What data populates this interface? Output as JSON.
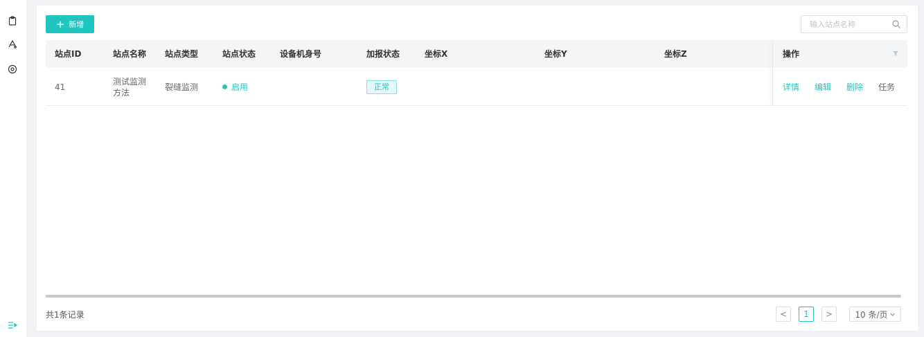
{
  "sidebar": {
    "icons": [
      "clipboard-icon",
      "station-icon",
      "settings-icon",
      "menu-collapse-icon"
    ]
  },
  "toolbar": {
    "add_label": "新增",
    "search_placeholder": "输入站点名称"
  },
  "table": {
    "headers": {
      "id": "站点ID",
      "name": "站点名称",
      "type": "站点类型",
      "status": "站点状态",
      "device": "设备机身号",
      "report": "加报状态",
      "x": "坐标X",
      "y": "坐标Y",
      "z": "坐标Z",
      "actions": "操作"
    },
    "rows": [
      {
        "id": "41",
        "name": "测试监测方法",
        "type": "裂缝监测",
        "status": "启用",
        "device": "",
        "report": "正常",
        "x": "",
        "y": "",
        "z": "",
        "actions": {
          "detail": "详情",
          "edit": "编辑",
          "delete": "删除",
          "task": "任务"
        }
      }
    ]
  },
  "footer": {
    "total": "共1条记录",
    "page": "1",
    "page_size": "10 条/页"
  },
  "colors": {
    "accent": "#1fc6bf",
    "background": "#f0f2f5",
    "header_bg": "#f4f5f7"
  }
}
